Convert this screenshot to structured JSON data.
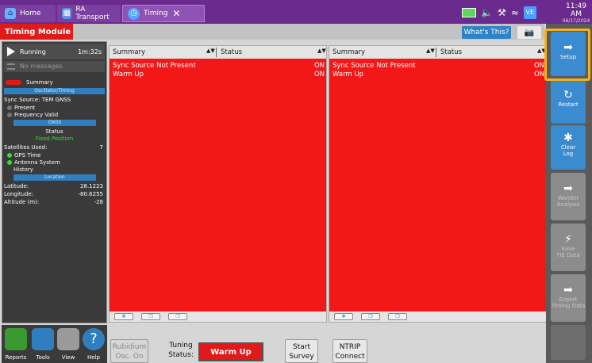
{
  "tabs": {
    "home": "Home",
    "ra_transport": "RA Transport",
    "timing": "Timing"
  },
  "status_bar": {
    "time": "11:49 AM",
    "date": "06/17/2024",
    "badge": "VE"
  },
  "module": {
    "title": "Timing Module",
    "whats_this": "What's This?"
  },
  "left_panel": {
    "state": "Running",
    "elapsed": "1m:32s",
    "messages": "No messages",
    "summary": "Summary",
    "oscillator_section": "Oscillator/Timing",
    "sync_source": "Sync Source:  TEM GNSS",
    "present": "Present",
    "frequency_valid": "Frequency Valid",
    "gnss_section": "GNSS",
    "status_label": "Status",
    "status_value": "Fixed Position",
    "satellites_label": "Satellites Used:",
    "satellites_value": "7",
    "gps_time": "GPS Time",
    "antenna_system": "Antenna System",
    "history": "History",
    "location_section": "Location",
    "latitude_label": "Latitude:",
    "latitude_value": "28.1223",
    "longitude_label": "Longitude:",
    "longitude_value": "-80.6255",
    "altitude_label": "Altitude (m):",
    "altitude_value": "-28"
  },
  "tables": [
    {
      "col1": "Summary",
      "col2": "Status",
      "rows": [
        {
          "name": "Sync Source Not Present",
          "status": "ON"
        },
        {
          "name": "Warm Up",
          "status": "ON"
        }
      ]
    },
    {
      "col1": "Summary",
      "col2": "Status",
      "rows": [
        {
          "name": "Sync Source Not Present",
          "status": "ON"
        },
        {
          "name": "Warm Up",
          "status": "ON"
        }
      ]
    }
  ],
  "bottom_nav": {
    "reports": "Reports",
    "tools": "Tools",
    "view": "View",
    "help": "Help"
  },
  "bottom_bar": {
    "rubidium_l1": "Rubidium",
    "rubidium_l2": "Osc. On",
    "tuning_l1": "Tuning",
    "tuning_l2": "Status:",
    "tuning_value": "Warm Up",
    "start_l1": "Start",
    "start_l2": "Survey",
    "ntrip_l1": "NTRIP",
    "ntrip_l2": "Connect"
  },
  "right_sidebar": {
    "setup": "Setup",
    "restart": "Restart",
    "clear_log_l1": "Clear",
    "clear_log_l2": "Log",
    "wander_l1": "Wander",
    "wander_l2": "Analysis",
    "save_tie_l1": "Save",
    "save_tie_l2": "TIE Data",
    "export_l1": "Export",
    "export_l2": "Timing Data"
  },
  "colors": {
    "alarm_red": "#f31818",
    "accent_blue": "#3a8bd0",
    "title_purple": "#6a2a8e",
    "highlight_orange": "#f5b21e"
  }
}
